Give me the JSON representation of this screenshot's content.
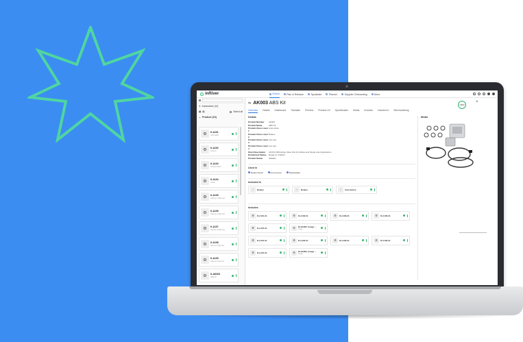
{
  "colors": {
    "background": "#3c8df2",
    "accent": "#1d6fe0",
    "status_ok": "#33b46e",
    "star": "#4fd6a0"
  },
  "app": {
    "logo": "inRiver",
    "nav": [
      {
        "label": "Enrich",
        "active": true,
        "icon": "enrich-icon"
      },
      {
        "label": "Plan & Release",
        "active": false,
        "icon": "plan-icon"
      },
      {
        "label": "Syndicate",
        "active": false,
        "icon": "syndicate-icon"
      },
      {
        "label": "Planner",
        "active": false,
        "icon": "planner-icon"
      },
      {
        "label": "Supplier Onboarding",
        "active": false,
        "icon": "supplier-icon"
      },
      {
        "label": "More",
        "active": false,
        "icon": "grid-icon"
      }
    ]
  },
  "left_panel": {
    "search_placeholder": "",
    "filter_label": "Automotive (10)",
    "select_all_label": "Select all",
    "group_label": "Product (10)",
    "items": [
      {
        "name": "K-A101",
        "sub": "Cell Cable"
      },
      {
        "name": "K-A102",
        "sub": "Planner"
      },
      {
        "name": "K-A103",
        "sub": "Xxl Pendulum"
      },
      {
        "name": "K-A104",
        "sub": "Cable"
      },
      {
        "name": "K-A105",
        "sub": "Planner Cable Set"
      },
      {
        "name": "K-A106",
        "sub": "Planner Cable Set"
      },
      {
        "name": "K-A107",
        "sub": "Planner Cable Set"
      },
      {
        "name": "K-A108",
        "sub": "Planner Plug Kits"
      },
      {
        "name": "K-A109",
        "sub": "Planner Plug Kits"
      },
      {
        "name": "K-AK003",
        "sub": "ABS Kit"
      }
    ]
  },
  "entity": {
    "code": "AK003",
    "name": "ABS Kit",
    "completeness": "100%",
    "tabs": [
      "Overview",
      "Details",
      "Dashboard",
      "Translate",
      "Preview",
      "Preview UX",
      "Specification",
      "Media",
      "Includes",
      "Included in",
      "Merchandising"
    ]
  },
  "details": {
    "title": "Details",
    "fields": [
      {
        "label": "Product Number",
        "value": "AK003"
      },
      {
        "label": "Product Name",
        "value": "ABS Kit"
      },
      {
        "label": "Product Class Level 1",
        "value": "Automotive"
      },
      {
        "label": "Product Class Level 2",
        "value": "Brakes"
      },
      {
        "label": "Product Class Level 3",
        "value": "(not set)"
      },
      {
        "label": "Product Class Level 4",
        "value": "(not set)"
      },
      {
        "label": "Short Description",
        "value": "24V/9V ABS Relay Valve Kits for Dollies and Single Axle Applications"
      },
      {
        "label": "Enrichment Status",
        "value": "Ready for Publish"
      },
      {
        "label": "Product Status",
        "value": "Sellable"
      }
    ]
  },
  "used_in": {
    "title": "Used in",
    "channels": [
      "Dealer Portal",
      "eCommerce",
      "Marketplace"
    ]
  },
  "included_in": {
    "title": "Included in",
    "items": [
      "Brakes",
      "Brakes",
      "Automotive"
    ]
  },
  "includes": {
    "title": "Includes",
    "rows": [
      [
        {
          "name": "R-A101-01",
          "sub": ""
        },
        {
          "name": "R-A102-01",
          "sub": ""
        },
        {
          "name": "R-A109-01",
          "sub": ""
        },
        {
          "name": "R-A106-01",
          "sub": ""
        }
      ],
      [
        {
          "name": "R-A107-01",
          "sub": ""
        },
        {
          "name": "M-AK003_Image ...",
          "sub": "Image"
        }
      ],
      [
        {
          "name": "R-A101-01",
          "sub": ""
        },
        {
          "name": "R-A102-01",
          "sub": ""
        },
        {
          "name": "R-A109-01",
          "sub": ""
        },
        {
          "name": "R-A106-01",
          "sub": ""
        }
      ],
      [
        {
          "name": "R-A107-01",
          "sub": ""
        },
        {
          "name": "M-AK003_Image ...",
          "sub": "Image"
        }
      ]
    ]
  },
  "media": {
    "title": "Media"
  }
}
